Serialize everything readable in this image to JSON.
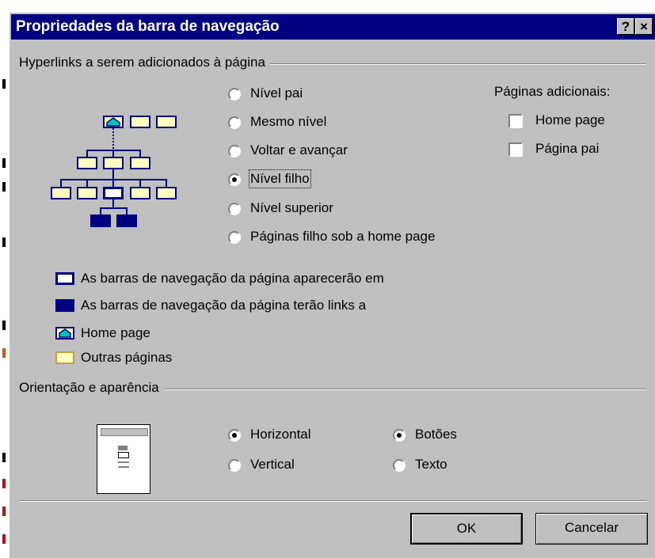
{
  "dialog": {
    "title": "Propriedades da barra de navegação",
    "help_button": "?",
    "close_button": "×"
  },
  "hyperlinks_group": {
    "label": "Hyperlinks a serem adicionados à página",
    "options": [
      {
        "label": "Nível pai",
        "checked": false
      },
      {
        "label": "Mesmo nível",
        "checked": false
      },
      {
        "label": "Voltar e avançar",
        "checked": false
      },
      {
        "label": "Nível filho",
        "checked": true
      },
      {
        "label": "Nível superior",
        "checked": false
      },
      {
        "label": "Páginas filho sob a home page",
        "checked": false
      }
    ]
  },
  "additional_pages": {
    "label": "Páginas adicionais:",
    "items": [
      {
        "label": "Home page",
        "checked": false
      },
      {
        "label": "Página pai",
        "checked": false
      }
    ]
  },
  "legend": {
    "items": [
      {
        "label": "As barras de navegação da página aparecerão em"
      },
      {
        "label": "As barras de navegação da página terão links a"
      },
      {
        "label": "Home page"
      },
      {
        "label": "Outras páginas"
      }
    ]
  },
  "appearance_group": {
    "label": "Orientação e aparência",
    "orientation": [
      {
        "label": "Horizontal",
        "checked": true
      },
      {
        "label": "Vertical",
        "checked": false
      }
    ],
    "style": [
      {
        "label": "Botões",
        "checked": true
      },
      {
        "label": "Texto",
        "checked": false
      }
    ]
  },
  "buttons": {
    "ok": "OK",
    "cancel": "Cancelar"
  },
  "colors": {
    "dialog_bg": "#c0c0c0",
    "titlebar": "#000080",
    "page_fill": "#ffffc0",
    "page_border": "#000080"
  }
}
